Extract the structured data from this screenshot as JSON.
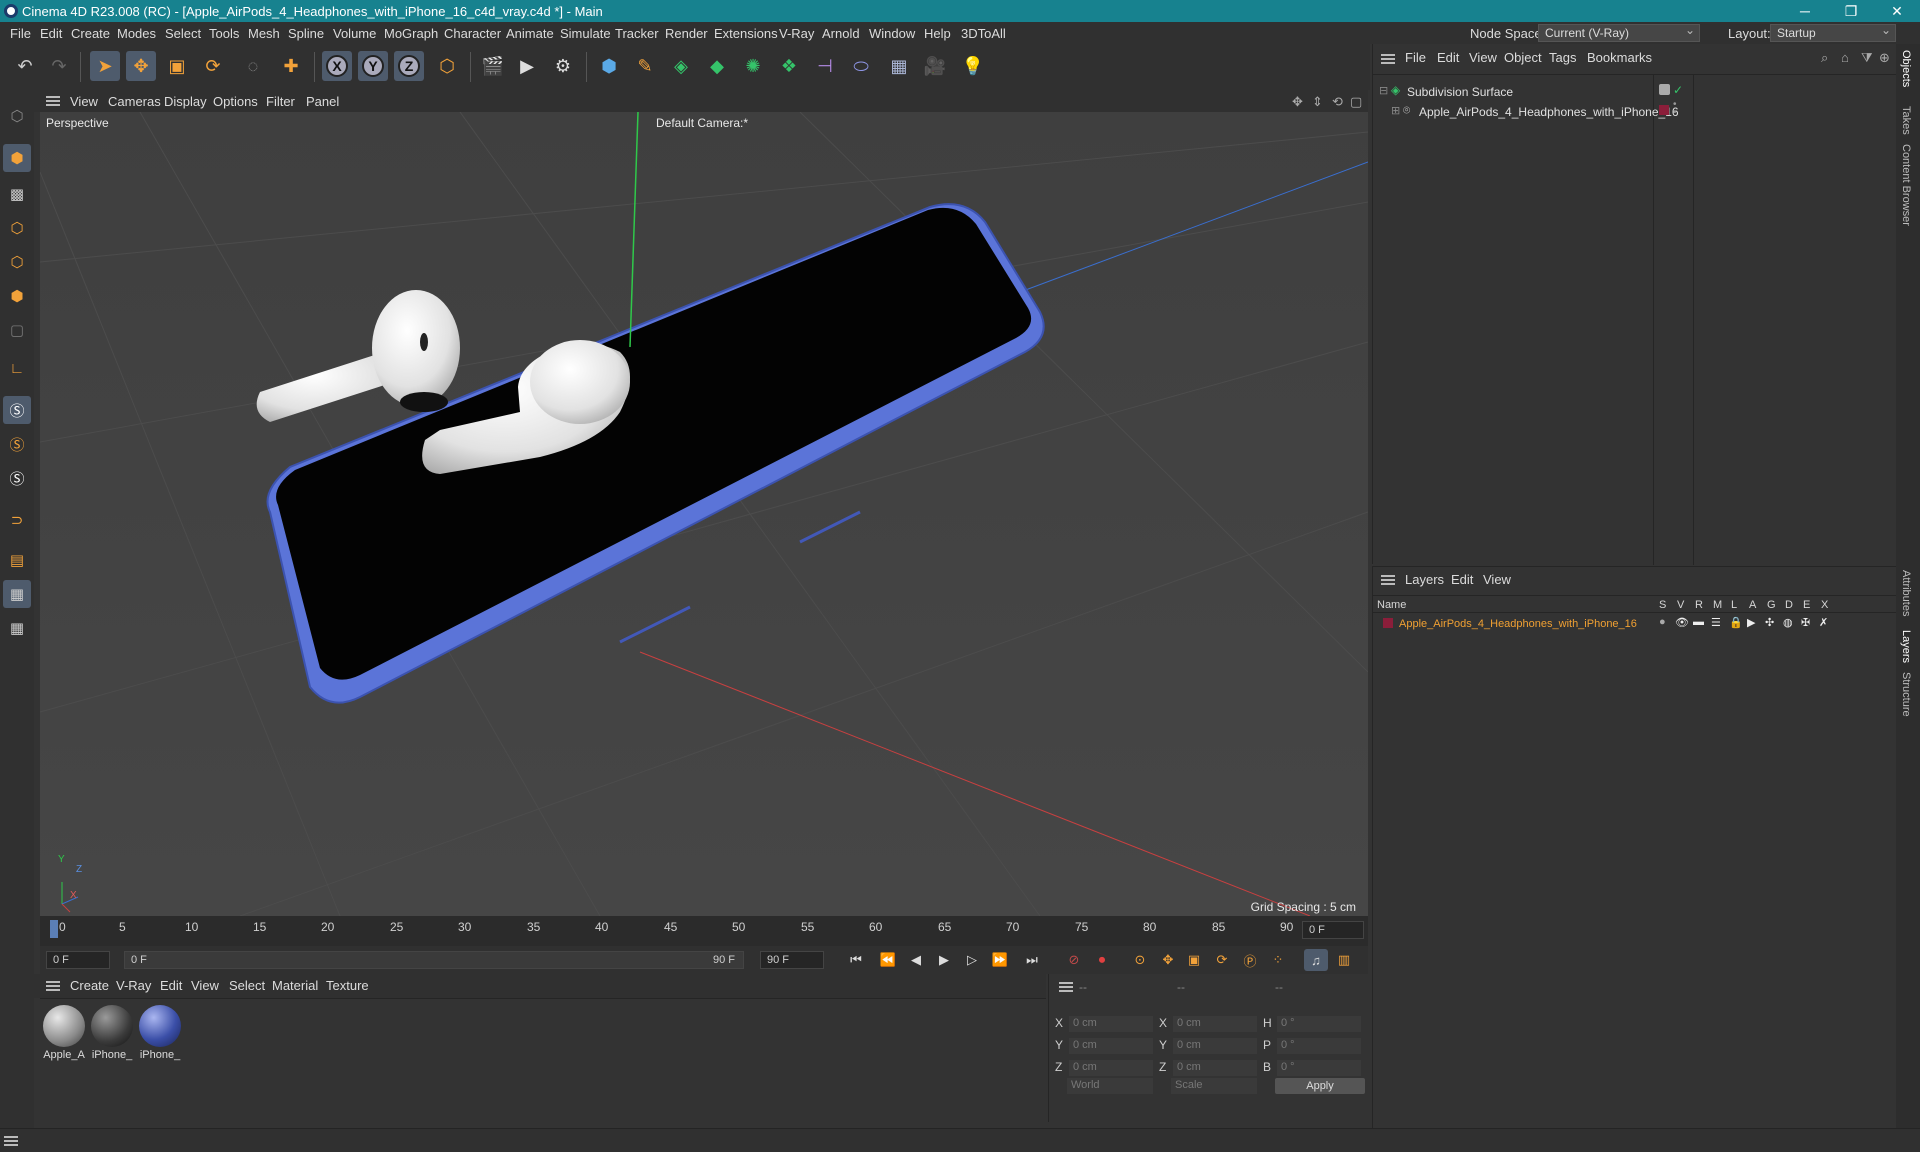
{
  "window": {
    "title": "Cinema 4D R23.008 (RC) - [Apple_AirPods_4_Headphones_with_iPhone_16_c4d_vray.c4d *] - Main",
    "controls": [
      "─",
      "❐",
      "✕"
    ]
  },
  "menubar": {
    "items": [
      "File",
      "Edit",
      "Create",
      "Modes",
      "Select",
      "Tools",
      "Mesh",
      "Spline",
      "Volume",
      "MoGraph",
      "Character",
      "Animate",
      "Simulate",
      "Tracker",
      "Render",
      "Extensions",
      "V-Ray",
      "Arnold",
      "Window",
      "Help",
      "3DToAll"
    ],
    "node_space_label": "Node Space:",
    "node_space_value": "Current (V-Ray)",
    "layout_label": "Layout:",
    "layout_value": "Startup"
  },
  "toolbar": {
    "icons": [
      "undo-icon",
      "redo-icon",
      "select-icon",
      "move-icon",
      "scale-icon",
      "rotate-icon",
      "live-select-icon",
      "add-icon",
      "x-axis-icon",
      "y-axis-icon",
      "z-axis-icon",
      "coord-system-icon",
      "render-region-icon",
      "render-view-icon",
      "render-settings-icon",
      "cube-icon",
      "pen-icon",
      "subdivide-icon",
      "extrude-icon",
      "cloner-icon",
      "array-icon",
      "symmetry-icon",
      "deformer-icon",
      "floor-icon",
      "camera-icon",
      "light-icon"
    ],
    "axis_labels": [
      "X",
      "Y",
      "Z"
    ]
  },
  "viewport": {
    "menu": [
      "View",
      "Cameras",
      "Display",
      "Options",
      "Filter",
      "Panel"
    ],
    "name": "Perspective",
    "camera": "Default Camera",
    "camera_suffix": ":*",
    "grid_spacing": "Grid Spacing : 5 cm",
    "axis_labels": [
      "Y",
      "Z",
      "X"
    ]
  },
  "timeline": {
    "ticks": [
      "0",
      "5",
      "10",
      "15",
      "20",
      "25",
      "30",
      "35",
      "40",
      "45",
      "50",
      "55",
      "60",
      "65",
      "70",
      "75",
      "80",
      "85",
      "90"
    ],
    "end_frame": "0 F"
  },
  "transport": {
    "current_frame": "0 F",
    "range_start": "0 F",
    "range_end": "90 F",
    "max_frame": "90 F"
  },
  "materials": {
    "menu": [
      "Create",
      "V-Ray",
      "Edit",
      "View",
      "Select",
      "Material",
      "Texture"
    ],
    "items": [
      {
        "label": "Apple_A",
        "color": "#9a9a9a"
      },
      {
        "label": "iPhone_",
        "color": "#4a4a4a"
      },
      {
        "label": "iPhone_",
        "color": "#3b4fa8"
      }
    ]
  },
  "coordinates": {
    "headers": [
      "--",
      "--",
      "--"
    ],
    "rows": [
      {
        "a": "X",
        "a_val": "0 cm",
        "b": "X",
        "b_val": "0 cm",
        "c": "H",
        "c_val": "0 °"
      },
      {
        "a": "Y",
        "a_val": "0 cm",
        "b": "Y",
        "b_val": "0 cm",
        "c": "P",
        "c_val": "0 °"
      },
      {
        "a": "Z",
        "a_val": "0 cm",
        "b": "Z",
        "b_val": "0 cm",
        "c": "B",
        "c_val": "0 °"
      }
    ],
    "mode_world": "World",
    "mode_scale": "Scale",
    "apply": "Apply"
  },
  "object_manager": {
    "menu": [
      "File",
      "Edit",
      "View",
      "Object",
      "Tags",
      "Bookmarks"
    ],
    "objects": [
      {
        "name": "Subdivision Surface"
      },
      {
        "name": "Apple_AirPods_4_Headphones_with_iPhone_16"
      }
    ]
  },
  "layer_manager": {
    "menu": [
      "Layers",
      "Edit",
      "View"
    ],
    "columns": [
      "Name",
      "S",
      "V",
      "R",
      "M",
      "L",
      "A",
      "G",
      "D",
      "E",
      "X"
    ],
    "layers": [
      {
        "name": "Apple_AirPods_4_Headphones_with_iPhone_16",
        "color": "#8b1e3a"
      }
    ]
  },
  "side_tabs": [
    "Objects",
    "Takes",
    "Content Browser",
    "Attributes",
    "Layers",
    "Structure"
  ],
  "colors": {
    "titlebar": "#17828f",
    "accent": "#ff9d00",
    "phone_body": "#5b74d8",
    "layer_name": "#f0a033"
  }
}
